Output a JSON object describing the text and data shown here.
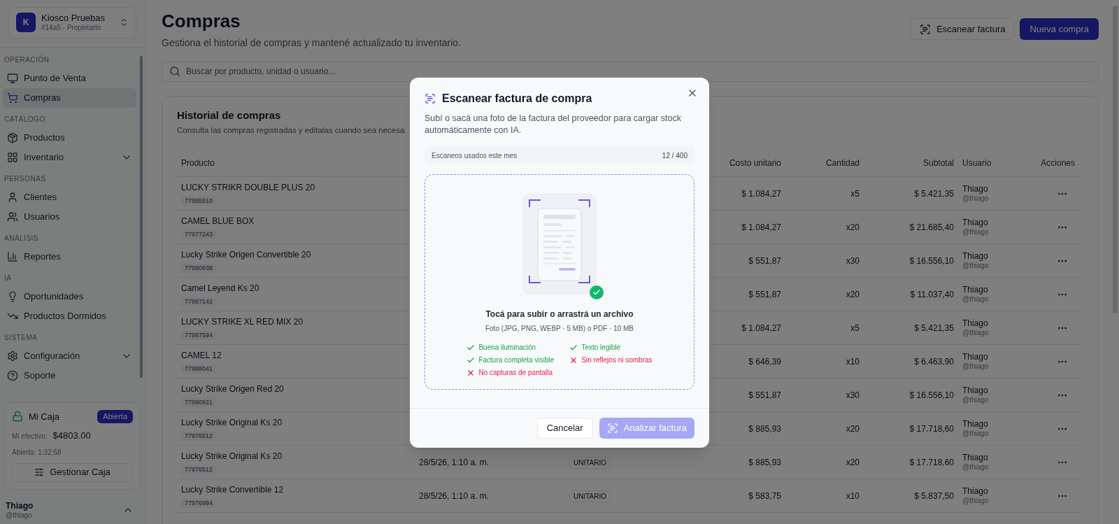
{
  "workspace": {
    "initial": "K",
    "name": "Kiosco Pruebas",
    "subtitle": "#14a5 - Propietario"
  },
  "sidebar": {
    "sections": [
      {
        "title": "OPERACIÓN",
        "items": [
          {
            "label": "Punto de Venta",
            "kind": "link",
            "selected": false
          },
          {
            "label": "Compras",
            "kind": "link",
            "selected": true
          }
        ]
      },
      {
        "title": "CATÁLOGO",
        "items": [
          {
            "label": "Productos",
            "kind": "link",
            "selected": false
          },
          {
            "label": "Inventario",
            "kind": "group",
            "expanded": false,
            "selected": false
          }
        ]
      },
      {
        "title": "PERSONAS",
        "items": [
          {
            "label": "Clientes",
            "kind": "link",
            "selected": false
          },
          {
            "label": "Usuarios",
            "kind": "link",
            "selected": false
          }
        ]
      },
      {
        "title": "ANÁLISIS",
        "items": [
          {
            "label": "Reportes",
            "kind": "link",
            "selected": false
          }
        ]
      },
      {
        "title": "IA",
        "items": [
          {
            "label": "Oportunidades",
            "kind": "link",
            "selected": false
          },
          {
            "label": "Productos Dormidos",
            "kind": "link",
            "selected": false
          }
        ]
      },
      {
        "title": "SISTEMA",
        "items": [
          {
            "label": "Configuración",
            "kind": "group",
            "expanded": false,
            "selected": false
          },
          {
            "label": "Soporte",
            "kind": "link",
            "selected": false
          }
        ]
      }
    ],
    "cash": {
      "title": "Mi Caja",
      "status": "Abierta",
      "open": true,
      "cash_label": "Mi efectivo:",
      "cash_value": "$4803.00",
      "opened": "Abierta: 1:32:58",
      "button": "Gestionar Caja"
    },
    "user": {
      "name": "Thiago",
      "handle": "@thiago",
      "expanded": true
    }
  },
  "header": {
    "title": "Compras",
    "subtitle": "Gestiona el historial de compras y mantené actualizado tu inventario.",
    "buttons": [
      {
        "label": "Escanear factura",
        "kind": "secondary"
      },
      {
        "label": "Nueva compra",
        "kind": "primary"
      }
    ]
  },
  "search": {
    "placeholder": "Buscar por producto, unidad o usuario..."
  },
  "history": {
    "title": "Historial de compras",
    "subtitle": "Consulta las compras registradas y editalas cuando sea necesa",
    "columns": [
      "Producto",
      "",
      "",
      "Costo unitario",
      "Cantidad",
      "Subtotal",
      "Usuario",
      "Acciones"
    ],
    "rows": [
      {
        "product": "LUCKY STRIKR DOUBLE PLUS 20",
        "code": "77985910",
        "unit_cost": "$ 1.084,27",
        "qty": "x5",
        "subtotal": "$ 5.421,35",
        "user": "Thiago",
        "handle": "@thiago"
      },
      {
        "product": "CAMEL BLUE BOX",
        "code": "77977243",
        "unit_cost": "$ 1.084,27",
        "qty": "x20",
        "subtotal": "$ 21.685,40",
        "user": "Thiago",
        "handle": "@thiago"
      },
      {
        "product": "Lucky Strike Origen Convertible 20",
        "code": "77990938",
        "unit_cost": "$ 551,87",
        "qty": "x30",
        "subtotal": "$ 16.556,10",
        "user": "Thiago",
        "handle": "@thiago"
      },
      {
        "product": "Camel Leyend Ks 20",
        "code": "77997142",
        "unit_cost": "$ 551,87",
        "qty": "x20",
        "subtotal": "$ 11.037,40",
        "user": "Thiago",
        "handle": "@thiago"
      },
      {
        "product": "LUCKY STRIKE XL RED MIX 20",
        "code": "77987594",
        "unit_cost": "$ 1.084,27",
        "qty": "x5",
        "subtotal": "$ 5.421,35",
        "user": "Thiago",
        "handle": "@thiago"
      },
      {
        "product": "CAMEL 12",
        "code": "77988041",
        "unit_cost": "$ 646,39",
        "qty": "x10",
        "subtotal": "$ 6.463,90",
        "user": "Thiago",
        "handle": "@thiago"
      },
      {
        "product": "Lucky Strike Origen Red 20",
        "code": "77990921",
        "unit_cost": "$ 551,87",
        "qty": "x30",
        "subtotal": "$ 16.556,10",
        "user": "Thiago",
        "handle": "@thiago"
      },
      {
        "product": "Lucky Strike Original Ks 20",
        "code": "77976512",
        "unit_cost": "$ 885,93",
        "qty": "x20",
        "subtotal": "$ 17.718,60",
        "user": "Thiago",
        "handle": "@thiago"
      },
      {
        "product": "Lucky Strike Original Ks 20",
        "code": "77976512",
        "date": "28/5/26, 1:10 a. m.",
        "unit": "UNITARIO",
        "unit_cost": "$ 885,93",
        "qty": "x20",
        "subtotal": "$ 17.718,60",
        "user": "Thiago",
        "handle": "@thiago"
      },
      {
        "product": "Lucky Strike Convertible 12",
        "code": "77976994",
        "date": "28/5/26, 1:10 a. m.",
        "unit": "UNITARIO",
        "unit_cost": "$ 583,75",
        "qty": "x10",
        "subtotal": "$ 5.837,50",
        "user": "Thiago",
        "handle": "@thiago"
      }
    ]
  },
  "dialog": {
    "title": "Escanear factura de compra",
    "description": "Subí o sacá una foto de la factura del proveedor para cargar stock automáticamente con IA.",
    "usage_label": "Escaneos usados este mes",
    "usage_value": "12 / 400",
    "drop_title": "Tocá para subir o arrastrá un archivo",
    "drop_hint": "Foto (JPG, PNG, WEBP · 5 MB) o PDF · 10 MB",
    "tips": [
      {
        "label": "Buena iluminación",
        "passed": true
      },
      {
        "label": "Texto legible",
        "passed": true
      },
      {
        "label": "Factura completa visible",
        "passed": true
      },
      {
        "label": "Sin reflejos ni sombras",
        "passed": false
      },
      {
        "label": "No capturas de pantalla",
        "passed": false
      }
    ],
    "buttons": [
      {
        "label": "Cancelar",
        "kind": "secondary",
        "disabled": false
      },
      {
        "label": "Analizar factura",
        "kind": "primary",
        "disabled": true
      }
    ]
  }
}
